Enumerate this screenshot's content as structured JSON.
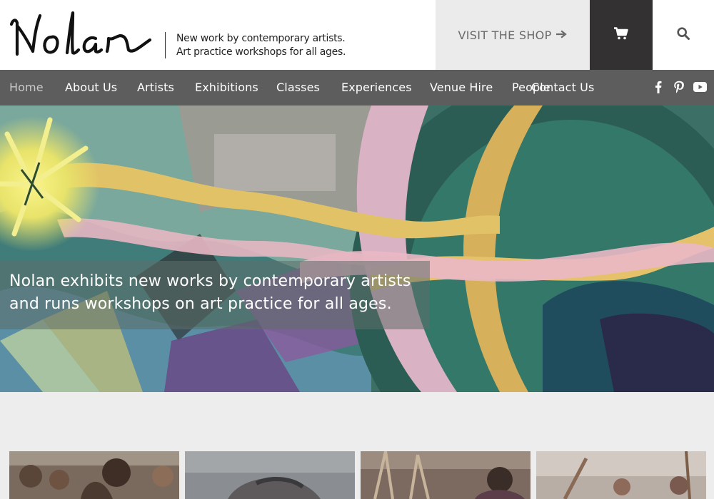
{
  "brand": {
    "logo_text": "Nolan",
    "tagline_line1": "New work by contemporary artists.",
    "tagline_line2": "Art practice workshops for all ages."
  },
  "header": {
    "shop_label": "VISIT THE SHOP",
    "shop_icon": "arrow-right-icon",
    "cart_icon": "shopping-cart-icon",
    "search_icon": "search-icon"
  },
  "nav": {
    "items": [
      {
        "label": "Home",
        "active": true
      },
      {
        "label": "About Us"
      },
      {
        "label": "Artists"
      },
      {
        "label": "Exhibitions"
      },
      {
        "label": "Classes"
      },
      {
        "label": "Experiences"
      },
      {
        "label": "Venue Hire"
      },
      {
        "label": "People"
      },
      {
        "label": "Contact Us"
      }
    ],
    "social": [
      "facebook-icon",
      "pinterest-icon",
      "youtube-icon"
    ]
  },
  "hero": {
    "caption_line1": "Nolan exhibits new works by contemporary artists",
    "caption_line2": "and runs workshops on art practice for all ages."
  },
  "colors": {
    "nav_bg": "#5e5d5d",
    "cart_bg": "#333131",
    "shop_bg": "#ebebeb",
    "page_bg": "#ededed"
  }
}
